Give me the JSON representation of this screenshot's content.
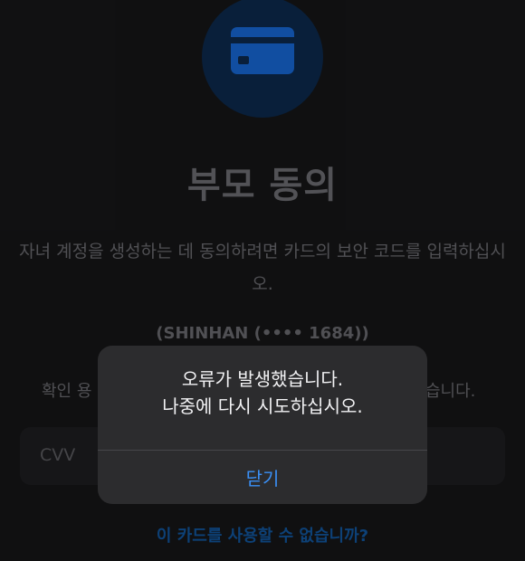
{
  "colors": {
    "background": "#131314",
    "icon_circle": "#0b2442",
    "card_icon": "#1459b8",
    "alert_background": "#2c2c2e",
    "accent": "#3a8ff5",
    "link": "#0f4a88"
  },
  "page": {
    "title": "부모 동의",
    "description_line1": "자녀 계정을 생성하는 데 동의하려면 카드의 보안 코드를 입력하십시",
    "description_line2": "오.",
    "card_info": "(SHINHAN (•••• 1684))",
    "confirm_text_left": "확인 용",
    "confirm_text_right": "습니다.",
    "cvv_placeholder": "CVV",
    "link_text": "이 카드를 사용할 수 없습니까?",
    "icon": "credit-card-icon"
  },
  "alert": {
    "message_line1": "오류가 발생했습니다.",
    "message_line2": "나중에 다시 시도하십시오.",
    "close_label": "닫기"
  }
}
